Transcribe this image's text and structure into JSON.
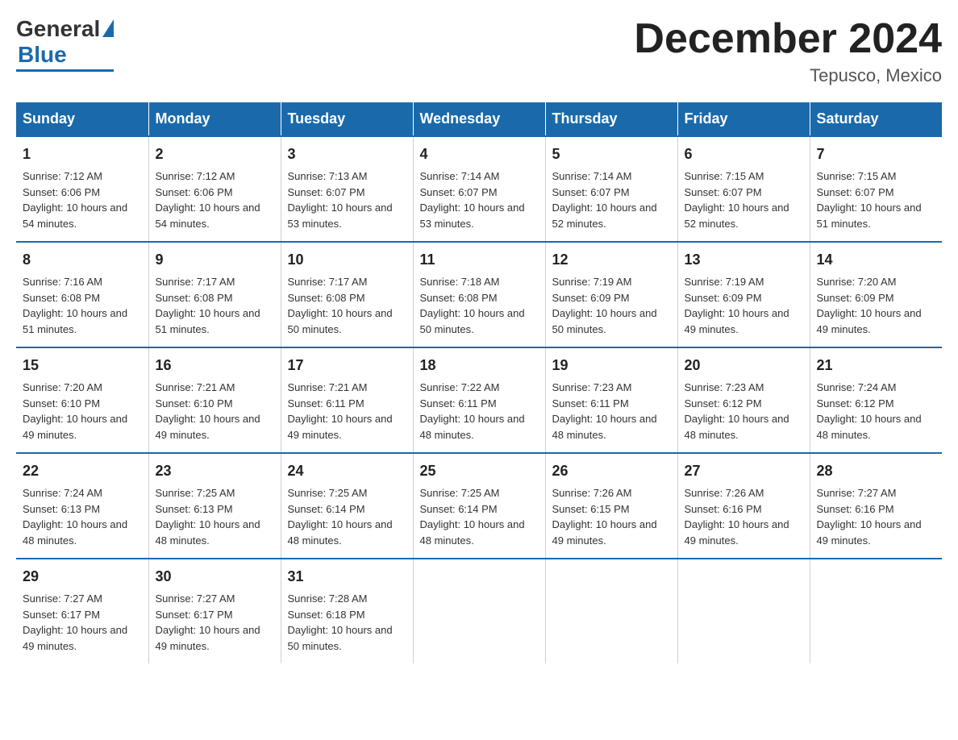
{
  "header": {
    "logo_general": "General",
    "logo_blue": "Blue",
    "month_title": "December 2024",
    "location": "Tepusco, Mexico"
  },
  "days_of_week": [
    "Sunday",
    "Monday",
    "Tuesday",
    "Wednesday",
    "Thursday",
    "Friday",
    "Saturday"
  ],
  "weeks": [
    [
      {
        "day": "1",
        "sunrise": "7:12 AM",
        "sunset": "6:06 PM",
        "daylight": "10 hours and 54 minutes."
      },
      {
        "day": "2",
        "sunrise": "7:12 AM",
        "sunset": "6:06 PM",
        "daylight": "10 hours and 54 minutes."
      },
      {
        "day": "3",
        "sunrise": "7:13 AM",
        "sunset": "6:07 PM",
        "daylight": "10 hours and 53 minutes."
      },
      {
        "day": "4",
        "sunrise": "7:14 AM",
        "sunset": "6:07 PM",
        "daylight": "10 hours and 53 minutes."
      },
      {
        "day": "5",
        "sunrise": "7:14 AM",
        "sunset": "6:07 PM",
        "daylight": "10 hours and 52 minutes."
      },
      {
        "day": "6",
        "sunrise": "7:15 AM",
        "sunset": "6:07 PM",
        "daylight": "10 hours and 52 minutes."
      },
      {
        "day": "7",
        "sunrise": "7:15 AM",
        "sunset": "6:07 PM",
        "daylight": "10 hours and 51 minutes."
      }
    ],
    [
      {
        "day": "8",
        "sunrise": "7:16 AM",
        "sunset": "6:08 PM",
        "daylight": "10 hours and 51 minutes."
      },
      {
        "day": "9",
        "sunrise": "7:17 AM",
        "sunset": "6:08 PM",
        "daylight": "10 hours and 51 minutes."
      },
      {
        "day": "10",
        "sunrise": "7:17 AM",
        "sunset": "6:08 PM",
        "daylight": "10 hours and 50 minutes."
      },
      {
        "day": "11",
        "sunrise": "7:18 AM",
        "sunset": "6:08 PM",
        "daylight": "10 hours and 50 minutes."
      },
      {
        "day": "12",
        "sunrise": "7:19 AM",
        "sunset": "6:09 PM",
        "daylight": "10 hours and 50 minutes."
      },
      {
        "day": "13",
        "sunrise": "7:19 AM",
        "sunset": "6:09 PM",
        "daylight": "10 hours and 49 minutes."
      },
      {
        "day": "14",
        "sunrise": "7:20 AM",
        "sunset": "6:09 PM",
        "daylight": "10 hours and 49 minutes."
      }
    ],
    [
      {
        "day": "15",
        "sunrise": "7:20 AM",
        "sunset": "6:10 PM",
        "daylight": "10 hours and 49 minutes."
      },
      {
        "day": "16",
        "sunrise": "7:21 AM",
        "sunset": "6:10 PM",
        "daylight": "10 hours and 49 minutes."
      },
      {
        "day": "17",
        "sunrise": "7:21 AM",
        "sunset": "6:11 PM",
        "daylight": "10 hours and 49 minutes."
      },
      {
        "day": "18",
        "sunrise": "7:22 AM",
        "sunset": "6:11 PM",
        "daylight": "10 hours and 48 minutes."
      },
      {
        "day": "19",
        "sunrise": "7:23 AM",
        "sunset": "6:11 PM",
        "daylight": "10 hours and 48 minutes."
      },
      {
        "day": "20",
        "sunrise": "7:23 AM",
        "sunset": "6:12 PM",
        "daylight": "10 hours and 48 minutes."
      },
      {
        "day": "21",
        "sunrise": "7:24 AM",
        "sunset": "6:12 PM",
        "daylight": "10 hours and 48 minutes."
      }
    ],
    [
      {
        "day": "22",
        "sunrise": "7:24 AM",
        "sunset": "6:13 PM",
        "daylight": "10 hours and 48 minutes."
      },
      {
        "day": "23",
        "sunrise": "7:25 AM",
        "sunset": "6:13 PM",
        "daylight": "10 hours and 48 minutes."
      },
      {
        "day": "24",
        "sunrise": "7:25 AM",
        "sunset": "6:14 PM",
        "daylight": "10 hours and 48 minutes."
      },
      {
        "day": "25",
        "sunrise": "7:25 AM",
        "sunset": "6:14 PM",
        "daylight": "10 hours and 48 minutes."
      },
      {
        "day": "26",
        "sunrise": "7:26 AM",
        "sunset": "6:15 PM",
        "daylight": "10 hours and 49 minutes."
      },
      {
        "day": "27",
        "sunrise": "7:26 AM",
        "sunset": "6:16 PM",
        "daylight": "10 hours and 49 minutes."
      },
      {
        "day": "28",
        "sunrise": "7:27 AM",
        "sunset": "6:16 PM",
        "daylight": "10 hours and 49 minutes."
      }
    ],
    [
      {
        "day": "29",
        "sunrise": "7:27 AM",
        "sunset": "6:17 PM",
        "daylight": "10 hours and 49 minutes."
      },
      {
        "day": "30",
        "sunrise": "7:27 AM",
        "sunset": "6:17 PM",
        "daylight": "10 hours and 49 minutes."
      },
      {
        "day": "31",
        "sunrise": "7:28 AM",
        "sunset": "6:18 PM",
        "daylight": "10 hours and 50 minutes."
      },
      null,
      null,
      null,
      null
    ]
  ],
  "labels": {
    "sunrise": "Sunrise:",
    "sunset": "Sunset:",
    "daylight": "Daylight:"
  }
}
